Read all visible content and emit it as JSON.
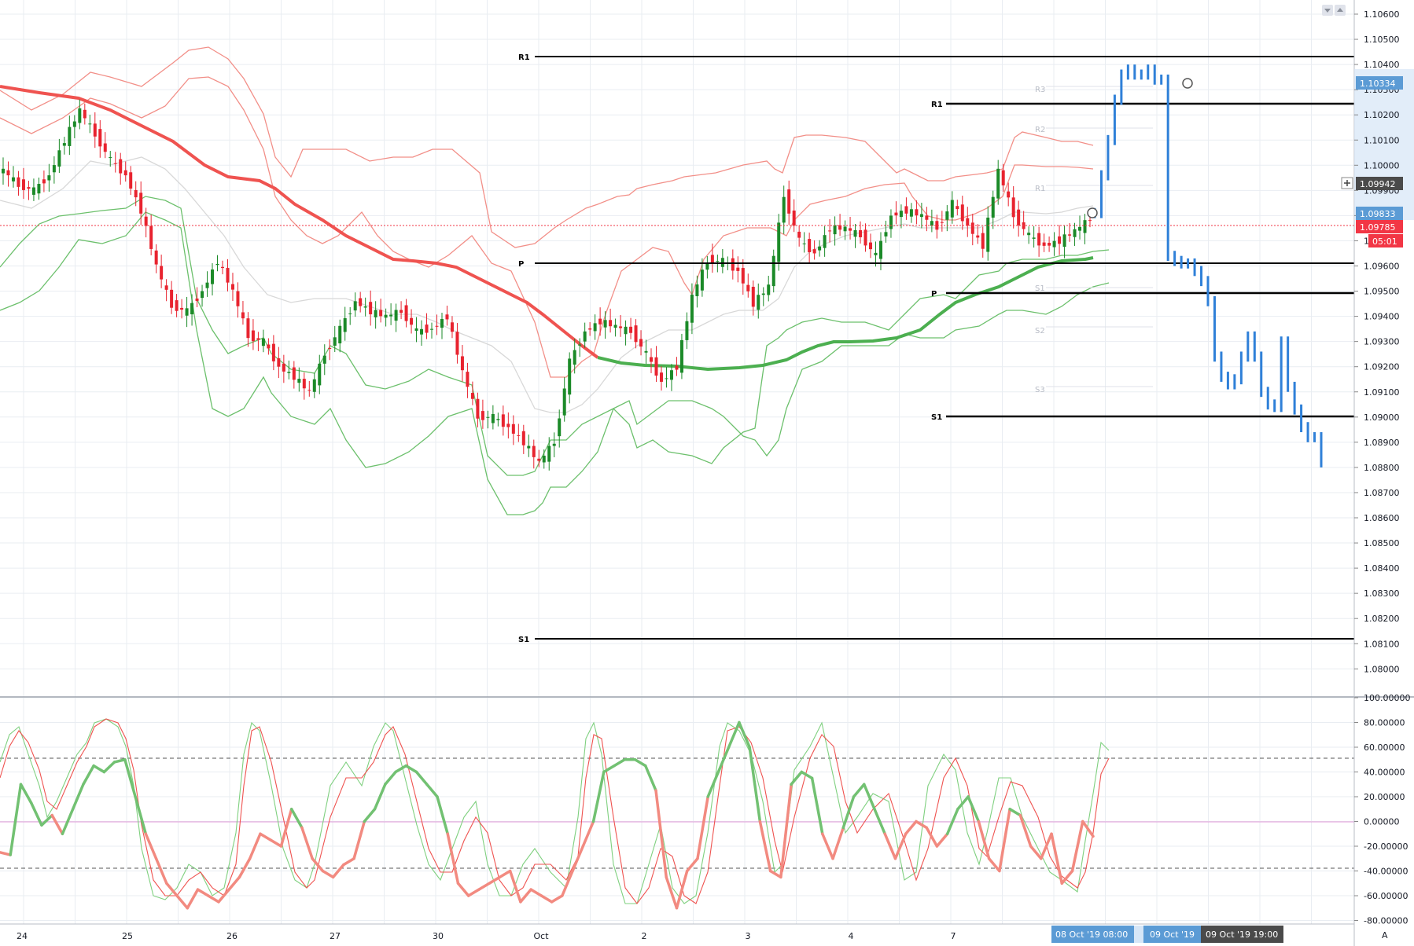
{
  "price_axis": {
    "ticks": [
      "1.10600",
      "1.10500",
      "1.10400",
      "1.10300",
      "1.10200",
      "1.10100",
      "1.10000",
      "1.09900",
      "1.09800",
      "1.09700",
      "1.09600",
      "1.09500",
      "1.09400",
      "1.09300",
      "1.09200",
      "1.09100",
      "1.09000",
      "1.08900",
      "1.08800",
      "1.08700",
      "1.08600",
      "1.08500",
      "1.08400",
      "1.08300",
      "1.08200",
      "1.08100",
      "1.08000"
    ],
    "price_badges": [
      {
        "label": "1.10334",
        "color": "#5b9bd5"
      },
      {
        "label": "1.09942",
        "color": "#4a4a4a"
      },
      {
        "label": "1.09833",
        "color": "#5b9bd5"
      },
      {
        "label": "1.09785",
        "color": "#f23645"
      },
      {
        "label": "05:01",
        "color": "#f23645"
      }
    ]
  },
  "osc_axis": {
    "ticks": [
      "100.00000",
      "80.00000",
      "60.00000",
      "40.00000",
      "20.00000",
      "0.00000",
      "-20.00000",
      "-40.00000",
      "-60.00000",
      "-80.00000"
    ]
  },
  "time_axis": {
    "labels": [
      "24",
      "25",
      "26",
      "27",
      "30",
      "Oct",
      "2",
      "3",
      "4",
      "7"
    ],
    "highlights": [
      "08 Oct '19   08:00",
      "09 Oct '19",
      "09 Oct '19   19:00"
    ],
    "corner_label": "A"
  },
  "pivots": {
    "outer": {
      "R1": "R1",
      "P": "P",
      "S1": "S1"
    },
    "inner": {
      "R1": "R1",
      "P": "P",
      "S1": "S1"
    },
    "faint": [
      "R3",
      "R2",
      "R1",
      "S1",
      "S2",
      "S3"
    ]
  },
  "colors": {
    "bull": "#1b8a28",
    "bear": "#e8232f",
    "ma_red": "#ef5350",
    "ma_green": "#4caf50",
    "forecast": "#2f80d8",
    "grid": "#e9edf2",
    "stoch_pos": "#72c172",
    "stoch_neg": "#f28a80"
  },
  "icons": [
    "scale-down-icon",
    "scale-up-icon",
    "crosshair-plus-icon"
  ],
  "chart_data": [
    {
      "type": "candlestick",
      "title": "",
      "ylim": [
        1.0795,
        1.1062
      ],
      "x_labels": [
        "24",
        "25",
        "26",
        "27",
        "30",
        "Oct",
        "2",
        "3",
        "4",
        "7"
      ],
      "pivots": {
        "R1_outer": 1.1044,
        "P_outer": 1.0964,
        "S1_outer": 1.0818,
        "R1_inner": 1.1025,
        "P_inner": 1.0952,
        "S1_inner": 1.0905
      },
      "current_price": 1.09785,
      "close_path": [
        1.0998,
        1.0992,
        1.099,
        1.0996,
        1.101,
        1.1022,
        1.1012,
        1.1002,
        1.0996,
        1.0982,
        1.096,
        1.0944,
        1.0942,
        1.095,
        1.0962,
        1.095,
        1.0932,
        1.093,
        1.092,
        1.0916,
        1.091,
        1.0925,
        1.0935,
        1.0946,
        1.0942,
        1.094,
        1.0942,
        1.0934,
        1.0935,
        1.094,
        1.0918,
        1.09,
        1.09,
        1.0896,
        1.089,
        1.0882,
        1.089,
        1.0922,
        1.0934,
        1.0938,
        1.0936,
        1.0934,
        1.0925,
        1.0914,
        1.092,
        1.0948,
        1.0962,
        1.0962,
        1.0958,
        1.0945,
        1.0952,
        1.0988,
        1.097,
        1.0965,
        1.0975,
        1.0975,
        1.0972,
        1.0964,
        1.098,
        1.0982,
        1.098,
        1.0975,
        1.0985,
        1.0976,
        1.0968,
        1.0998,
        1.098,
        1.0972,
        1.0968,
        1.097,
        1.0974,
        1.09785
      ],
      "forecast_path": [
        1.0981,
        1.0996,
        1.101,
        1.1026,
        1.1036,
        1.1038,
        1.1036,
        1.1036,
        1.1038,
        1.1034,
        1.1034,
        1.0964,
        1.0962,
        1.0961,
        1.0961,
        1.0958,
        1.0954,
        1.0946,
        1.0924,
        1.0916,
        1.0913,
        1.0915,
        1.0924,
        1.0932,
        1.0924,
        1.091,
        1.0905,
        1.0904,
        1.093,
        1.0912,
        1.0903,
        1.0896,
        1.0892,
        1.0892,
        1.0882
      ]
    },
    {
      "type": "line",
      "title": "",
      "ylim": [
        -80,
        100
      ],
      "levels": [
        53,
        -37
      ],
      "stoch_path": [
        -25,
        -27,
        30,
        15,
        -3,
        5,
        -10,
        10,
        30,
        45,
        40,
        48,
        50,
        20,
        -10,
        -30,
        -50,
        -60,
        -70,
        -55,
        -60,
        -65,
        -55,
        -45,
        -30,
        -10,
        -15,
        -20,
        10,
        -5,
        -30,
        -40,
        -45,
        -35,
        -30,
        0,
        10,
        30,
        40,
        45,
        40,
        30,
        20,
        -10,
        -50,
        -60,
        -55,
        -50,
        -45,
        -40,
        -65,
        -55,
        -60,
        -65,
        -60,
        -40,
        -20,
        0,
        40,
        45,
        50,
        50,
        45,
        25,
        -45,
        -70,
        -40,
        -30,
        20,
        40,
        60,
        80,
        60,
        0,
        -40,
        -45,
        30,
        40,
        35,
        -10,
        -30,
        -5,
        20,
        30,
        10,
        -10,
        -30,
        -10,
        0,
        -5,
        -20,
        -10,
        10,
        20,
        0,
        -30,
        -40,
        10,
        5,
        -20,
        -30,
        -10,
        -50,
        -40,
        0,
        -12
      ]
    }
  ]
}
